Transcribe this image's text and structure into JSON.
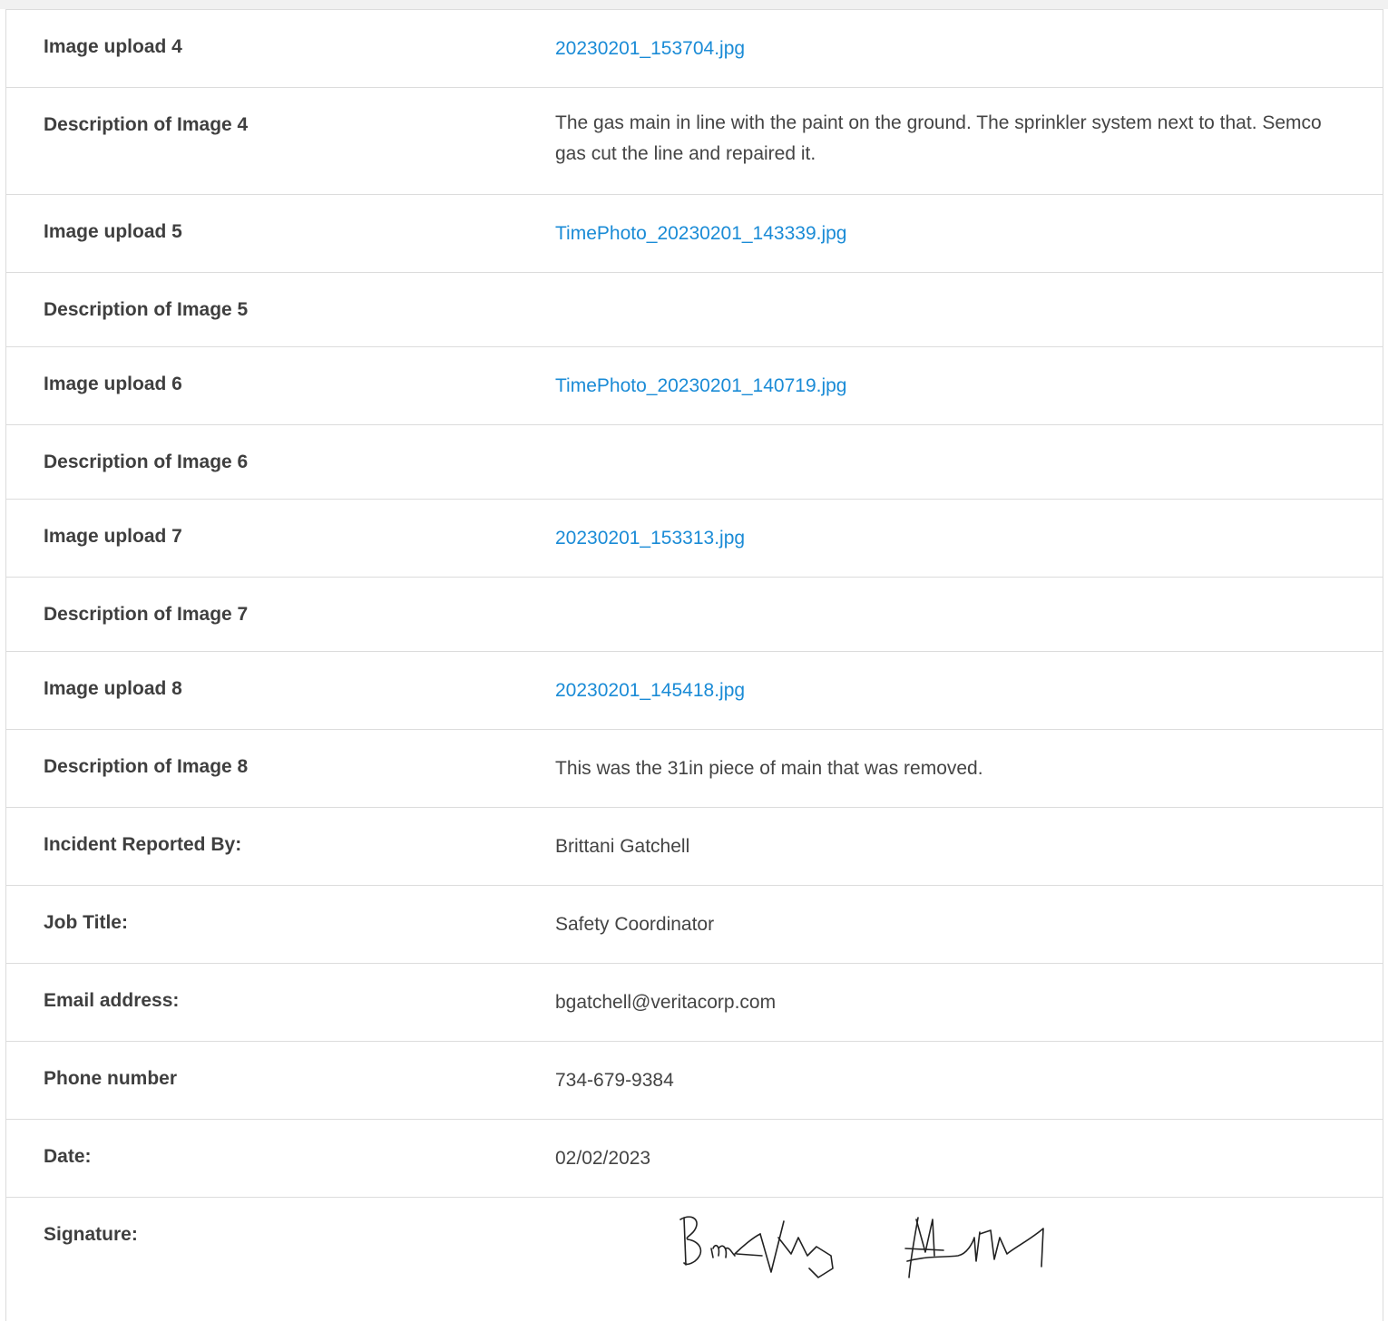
{
  "rows": [
    {
      "label": "Image upload 4",
      "value": "20230201_153704.jpg"
    },
    {
      "label": "Description of Image 4",
      "value": "The gas main in line with the paint on the ground. The sprinkler system next to that. Semco gas cut the line and repaired it."
    },
    {
      "label": "Image upload 5",
      "value": "TimePhoto_20230201_143339.jpg"
    },
    {
      "label": "Description of Image 5",
      "value": ""
    },
    {
      "label": "Image upload 6",
      "value": "TimePhoto_20230201_140719.jpg"
    },
    {
      "label": "Description of Image 6",
      "value": ""
    },
    {
      "label": "Image upload 7",
      "value": "20230201_153313.jpg"
    },
    {
      "label": "Description of Image 7",
      "value": ""
    },
    {
      "label": "Image upload 8",
      "value": "20230201_145418.jpg"
    },
    {
      "label": "Description of Image 8",
      "value": "This was the 31in piece of main that was removed."
    },
    {
      "label": "Incident Reported By:",
      "value": "Brittani Gatchell"
    },
    {
      "label": "Job Title:",
      "value": "Safety Coordinator"
    },
    {
      "label": "Email address:",
      "value": "bgatchell@veritacorp.com"
    },
    {
      "label": "Phone number",
      "value": "734-679-9384"
    },
    {
      "label": "Date:",
      "value": "02/02/2023"
    },
    {
      "label": "Signature:",
      "value": ""
    }
  ],
  "colors": {
    "link": "#1a8bd6",
    "label_text": "#3f3f3f",
    "value_text": "#444444",
    "border": "#dcdcdc"
  }
}
